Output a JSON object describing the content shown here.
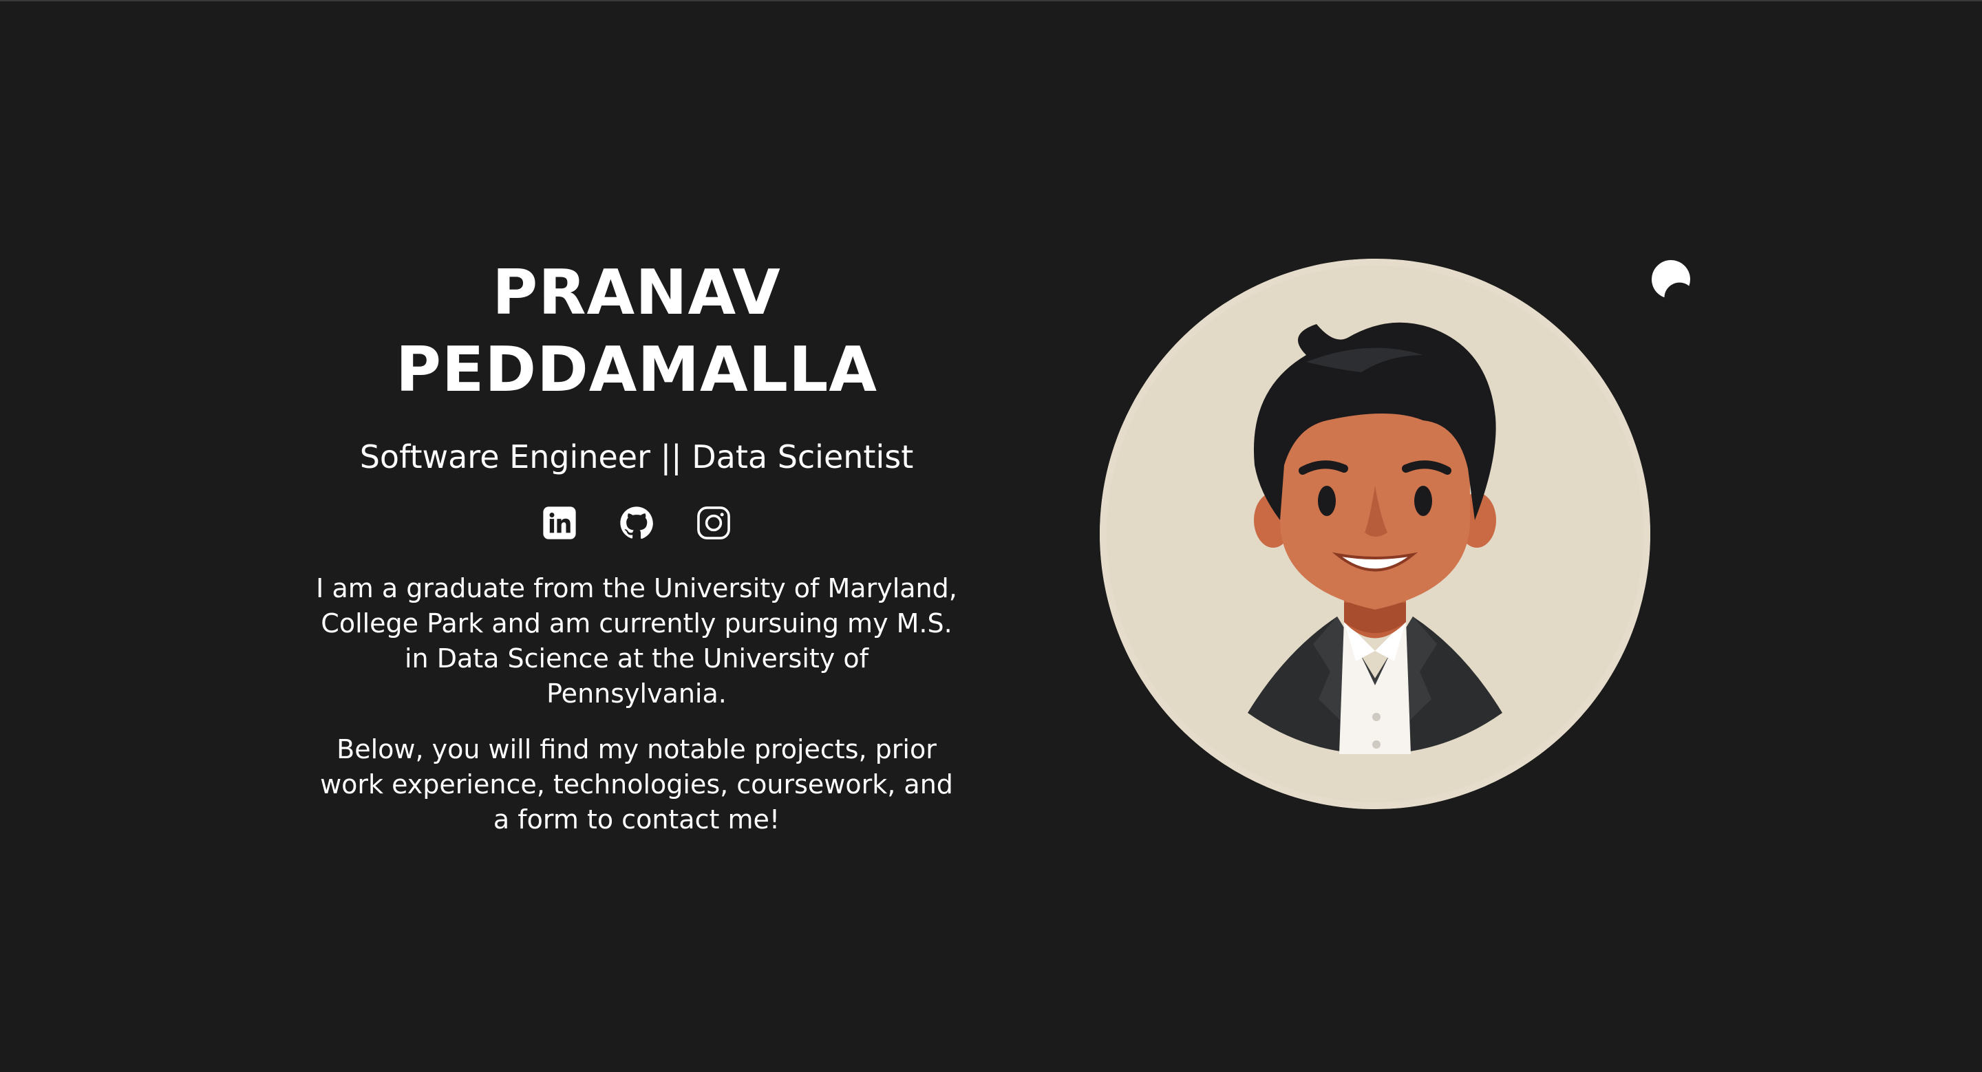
{
  "hero": {
    "name_line1": "PRANAV",
    "name_line2": "PEDDAMALLA",
    "tagline": "Software Engineer || Data Scientist",
    "bio_paragraph_1": "I am a graduate from the University of Maryland, College Park and am currently pursuing my M.S. in Data Science at the University of Pennsylvania.",
    "bio_paragraph_2": "Below, you will find my notable projects, prior work experience, technologies, coursework, and a form to contact me!"
  },
  "socials": [
    {
      "icon": "linkedin-icon"
    },
    {
      "icon": "github-icon"
    },
    {
      "icon": "instagram-icon"
    }
  ],
  "theme_toggle": {
    "icon": "moon-icon"
  },
  "colors": {
    "background": "#1b1b1b",
    "text": "#ffffff",
    "avatar_background": "#e5dccb"
  }
}
